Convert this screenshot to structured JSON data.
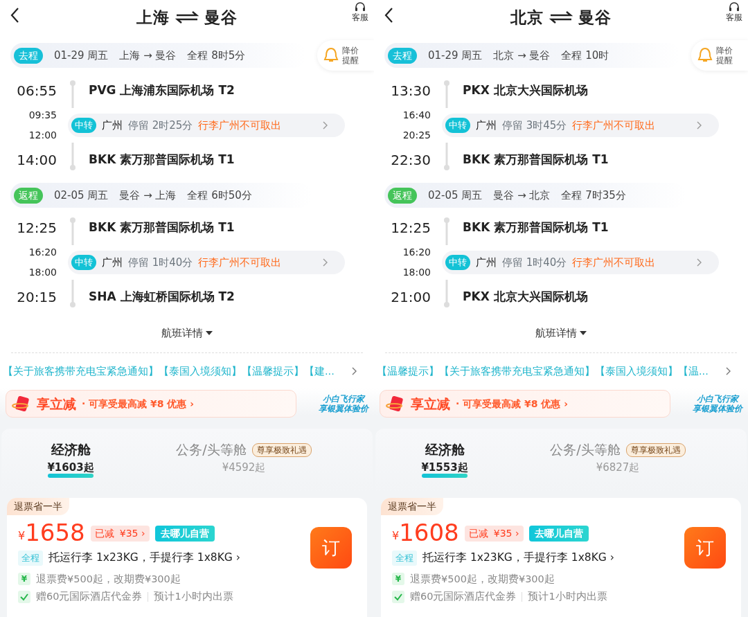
{
  "panels": [
    {
      "title_from": "上海",
      "title_to": "曼谷",
      "service_label": "客服",
      "price_alert": [
        "降价",
        "提醒"
      ],
      "trips": [
        {
          "kind": "outbound",
          "tag": "去程",
          "date": "01-29 周五",
          "route": "上海 → 曼谷",
          "duration": "全程 8时5分",
          "dep_time": "06:55",
          "dep_airport": "PVG 上海浦东国际机场 T2",
          "layover": {
            "arr_time": "09:35",
            "dep_time": "12:00",
            "tag": "中转",
            "city": "广州",
            "stay": "停留 2时25分",
            "note": "行李广州不可取出"
          },
          "arr_time": "14:00",
          "arr_airport": "BKK 素万那普国际机场 T1"
        },
        {
          "kind": "return",
          "tag": "返程",
          "date": "02-05 周五",
          "route": "曼谷 → 上海",
          "duration": "全程 6时50分",
          "dep_time": "12:25",
          "dep_airport": "BKK 素万那普国际机场 T1",
          "layover": {
            "arr_time": "16:20",
            "dep_time": "18:00",
            "tag": "中转",
            "city": "广州",
            "stay": "停留 1时40分",
            "note": "行李广州不可取出"
          },
          "arr_time": "20:15",
          "arr_airport": "SHA 上海虹桥国际机场 T2"
        }
      ],
      "details_link": "航班详情",
      "notices": "【关于旅客携带充电宝紧急通知】【泰国入境须知】【温馨提示】【建...",
      "promo": {
        "title": "享立减",
        "text": "· 可享受最高减 ¥8 优惠 ›",
        "side": [
          "小白飞行家",
          "享银翼体验价"
        ]
      },
      "cabins": [
        {
          "name": "经济舱",
          "price": "¥1603起",
          "selected": true
        },
        {
          "name": "公务/头等舱",
          "price": "¥4592起",
          "badge": "尊享极致礼遇",
          "selected": false
        }
      ],
      "offer": {
        "tag": "退票省一半",
        "currency": "¥",
        "price": "1658",
        "discount_label": "已减",
        "discount_amount": "¥35 ›",
        "self_label": "去哪儿自营",
        "book": "订",
        "bag_tag": "全程",
        "baggage": "托运行李 1x23KG，手提行李 1x8KG ›",
        "refund_icon": "¥",
        "refund": "退票费¥500起，改期费¥300起",
        "gift": "赠60元国际酒店代金券",
        "issue": "预计1小时内出票"
      }
    },
    {
      "title_from": "北京",
      "title_to": "曼谷",
      "service_label": "客服",
      "price_alert": [
        "降价",
        "提醒"
      ],
      "trips": [
        {
          "kind": "outbound",
          "tag": "去程",
          "date": "01-29 周五",
          "route": "北京 → 曼谷",
          "duration": "全程 10时",
          "dep_time": "13:30",
          "dep_airport": "PKX 北京大兴国际机场",
          "layover": {
            "arr_time": "16:40",
            "dep_time": "20:25",
            "tag": "中转",
            "city": "广州",
            "stay": "停留 3时45分",
            "note": "行李广州不可取出"
          },
          "arr_time": "22:30",
          "arr_airport": "BKK 素万那普国际机场 T1"
        },
        {
          "kind": "return",
          "tag": "返程",
          "date": "02-05 周五",
          "route": "曼谷 → 北京",
          "duration": "全程 7时35分",
          "dep_time": "12:25",
          "dep_airport": "BKK 素万那普国际机场 T1",
          "layover": {
            "arr_time": "16:20",
            "dep_time": "18:00",
            "tag": "中转",
            "city": "广州",
            "stay": "停留 1时40分",
            "note": "行李广州不可取出"
          },
          "arr_time": "21:00",
          "arr_airport": "PKX 北京大兴国际机场"
        }
      ],
      "details_link": "航班详情",
      "notices": "【温馨提示】【关于旅客携带充电宝紧急通知】【泰国入境须知】【温...",
      "promo": {
        "title": "享立减",
        "text": "· 可享受最高减 ¥8 优惠 ›",
        "side": [
          "小白飞行家",
          "享银翼体验价"
        ]
      },
      "cabins": [
        {
          "name": "经济舱",
          "price": "¥1553起",
          "selected": true
        },
        {
          "name": "公务/头等舱",
          "price": "¥6827起",
          "badge": "尊享极致礼遇",
          "selected": false
        }
      ],
      "offer": {
        "tag": "退票省一半",
        "currency": "¥",
        "price": "1608",
        "discount_label": "已减",
        "discount_amount": "¥35 ›",
        "self_label": "去哪儿自营",
        "book": "订",
        "bag_tag": "全程",
        "baggage": "托运行李 1x23KG，手提行李 1x8KG ›",
        "refund_icon": "¥",
        "refund": "退票费¥500起，改期费¥300起",
        "gift": "赠60元国际酒店代金券",
        "issue": "预计1小时内出票"
      }
    }
  ]
}
